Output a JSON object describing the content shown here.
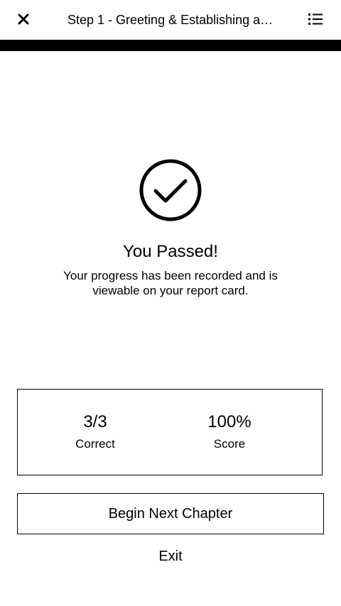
{
  "header": {
    "title": "Step 1 - Greeting & Establishing a…",
    "close_icon": "close-icon",
    "menu_icon": "list-menu-icon"
  },
  "progress": {
    "percent": 100,
    "color": "#000000"
  },
  "result": {
    "icon": "check-circle-icon",
    "title": "You Passed!",
    "message": "Your progress has been recorded and is viewable on your report card."
  },
  "stats": {
    "correct_value": "3/3",
    "correct_label": "Correct",
    "score_value": "100%",
    "score_label": "Score"
  },
  "actions": {
    "next_label": "Begin Next Chapter",
    "exit_label": "Exit"
  }
}
